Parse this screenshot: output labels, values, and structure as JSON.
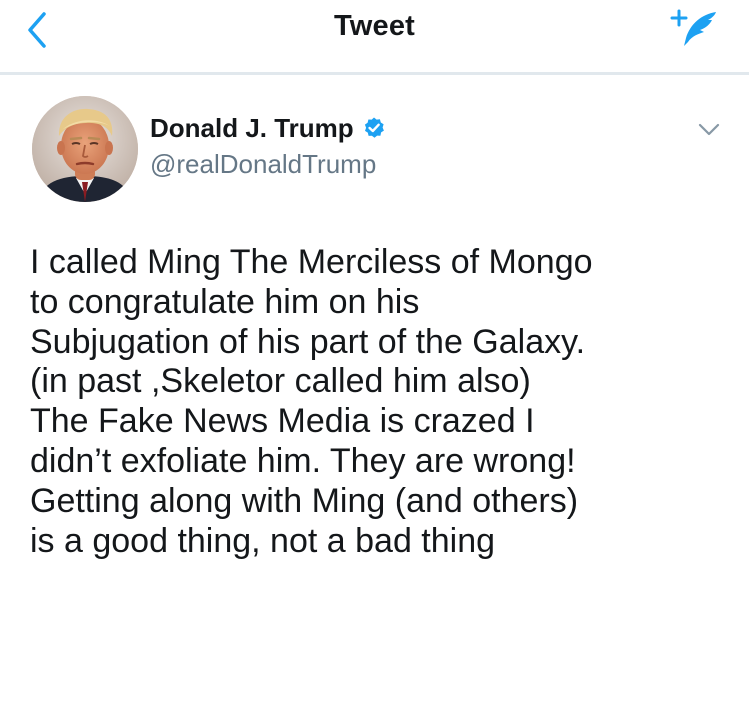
{
  "header": {
    "title": "Tweet",
    "back_icon": "chevron-left-icon",
    "compose_icon": "compose-tweet-icon",
    "accent_color": "#1da1f2"
  },
  "tweet": {
    "author": {
      "name": "Donald J. Trump",
      "handle": "@realDonaldTrump",
      "verified": true,
      "verified_icon": "verified-badge-icon"
    },
    "menu_icon": "chevron-down-icon",
    "text": "I called Ming The Merciless of Mongo\nto congratulate him on his\nSubjugation of his part of the Galaxy.\n(in past ,Skeletor called him also)\nThe Fake News Media is crazed I\ndidn’t exfoliate him. They are wrong!\nGetting along with Ming (and others)\nis a good thing, not a bad thing"
  }
}
